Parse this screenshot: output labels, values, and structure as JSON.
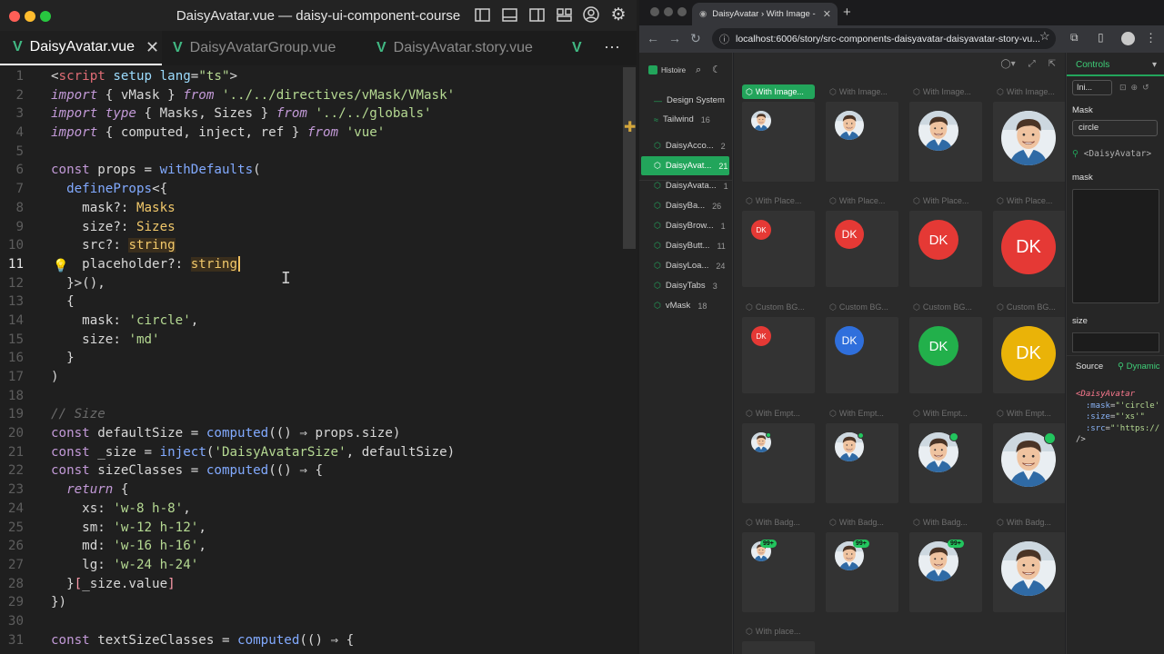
{
  "editor": {
    "window_title": "DaisyAvatar.vue — daisy-ui-component-course",
    "tabs": [
      {
        "label": "DaisyAvatar.vue",
        "active": true
      },
      {
        "label": "DaisyAvatarGroup.vue",
        "active": false
      },
      {
        "label": "DaisyAvatar.story.vue",
        "active": false
      }
    ],
    "tab_overflow": "⋯",
    "current_line": 11,
    "line_numbers": [
      "1",
      "2",
      "3",
      "4",
      "5",
      "6",
      "7",
      "8",
      "9",
      "10",
      "11",
      "12",
      "13",
      "14",
      "15",
      "16",
      "17",
      "18",
      "19",
      "20",
      "21",
      "22",
      "23",
      "24",
      "25",
      "26",
      "27",
      "28",
      "29",
      "30",
      "31"
    ]
  },
  "browser": {
    "tab_title": "DaisyAvatar › With Image - x",
    "new_tab": "+",
    "url": "localhost:6006/story/src-components-daisyavatar-daisyavatar-story-vu...",
    "app_name": "Histoire",
    "sidebar": [
      {
        "label": "Design System",
        "count": "",
        "active": false
      },
      {
        "label": "Tailwind",
        "count": "16",
        "active": false
      },
      {
        "label": "DaisyAcco...",
        "count": "2",
        "active": false
      },
      {
        "label": "DaisyAvat...",
        "count": "21",
        "active": true
      },
      {
        "label": "DaisyAvata...",
        "count": "1",
        "active": false
      },
      {
        "label": "DaisyBa...",
        "count": "26",
        "active": false
      },
      {
        "label": "DaisyBrow...",
        "count": "1",
        "active": false
      },
      {
        "label": "DaisyButt...",
        "count": "11",
        "active": false
      },
      {
        "label": "DaisyLoa...",
        "count": "24",
        "active": false
      },
      {
        "label": "DaisyTabs",
        "count": "3",
        "active": false
      },
      {
        "label": "vMask",
        "count": "18",
        "active": false
      }
    ],
    "variant_rows": [
      {
        "labels": [
          "With Image...",
          "With Image...",
          "With Image...",
          "With Image..."
        ],
        "kind": "image"
      },
      {
        "labels": [
          "With Place...",
          "With Place...",
          "With Place...",
          "With Place..."
        ],
        "kind": "placeholder"
      },
      {
        "labels": [
          "Custom BG...",
          "Custom BG...",
          "Custom BG...",
          "Custom BG..."
        ],
        "kind": "custom-bg"
      },
      {
        "labels": [
          "With Empt...",
          "With Empt...",
          "With Empt...",
          "With Empt..."
        ],
        "kind": "empty-badge"
      },
      {
        "labels": [
          "With Badg...",
          "With Badg...",
          "With Badg...",
          "With Badg..."
        ],
        "kind": "badge"
      },
      {
        "labels": [
          "With place..."
        ],
        "kind": "partial"
      }
    ],
    "placeholder_initials": "DK",
    "badge_text": "99+",
    "custom_bg_colors": [
      "#e53935",
      "#2f6fdc",
      "#22b04b",
      "#eab308"
    ],
    "placeholder_color": "#e53935",
    "controls": {
      "tab": "Controls",
      "init_select": "Ini...",
      "mask_label": "Mask",
      "mask_value": "circle",
      "component_tag": "<DaisyAvatar>",
      "mask_field_label": "mask",
      "size_label": "size",
      "source_tab": "Source",
      "dynamic_tab": "Dynamic"
    }
  }
}
